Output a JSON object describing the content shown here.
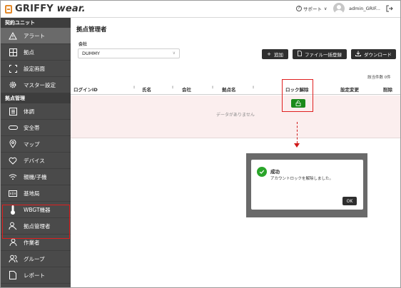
{
  "app": {
    "logo_text": "GRIFFY",
    "logo_text_italic": "wear.",
    "support_label": "サポート",
    "user_name": "admin_GRIF..."
  },
  "sidebar": {
    "section_contract": "契約ユニット",
    "contract_items": [
      {
        "label": "アラート",
        "icon": "warning-icon"
      },
      {
        "label": "拠点",
        "icon": "grid-icon"
      },
      {
        "label": "設定画面",
        "icon": "frame-icon"
      },
      {
        "label": "マスター設定",
        "icon": "gear-icon"
      }
    ],
    "section_site": "拠点管理",
    "site_items": [
      {
        "label": "体調",
        "icon": "list-icon"
      },
      {
        "label": "安全帯",
        "icon": "belt-icon"
      },
      {
        "label": "マップ",
        "icon": "map-pin-icon"
      },
      {
        "label": "デバイス",
        "icon": "heart-icon"
      },
      {
        "label": "親機/子機",
        "icon": "wifi-icon"
      },
      {
        "label": "基地局",
        "icon": "tower-icon"
      },
      {
        "label": "WBGT機器",
        "icon": "thermometer-icon"
      },
      {
        "label": "拠点管理者",
        "icon": "admin-user-icon"
      },
      {
        "label": "作業者",
        "icon": "user-icon"
      },
      {
        "label": "グループ",
        "icon": "group-icon"
      },
      {
        "label": "レポート",
        "icon": "report-icon"
      }
    ]
  },
  "main": {
    "title": "拠点管理者",
    "company_label": "会社",
    "company_value": "DUMMY",
    "buttons": {
      "add": "追加",
      "bulk": "ファイル一括登録",
      "download": "ダウンロード"
    },
    "count_label": "該当件数",
    "count_value": "0件",
    "columns": {
      "login_id": "ログインID",
      "name": "氏名",
      "company": "会社",
      "site_name": "拠点名",
      "lock_release": "ロック解除",
      "settings_change": "設定変更",
      "delete": "削除"
    },
    "empty_text": "データがありません"
  },
  "dialog": {
    "title": "成功",
    "message": "アカウントロックを解除しました。",
    "ok_label": "OK"
  },
  "colors": {
    "sidebar_bg": "#4a4a4a",
    "button_dark": "#2f2f2f",
    "success_green": "#2aa52a",
    "highlight_red": "#e02020"
  }
}
